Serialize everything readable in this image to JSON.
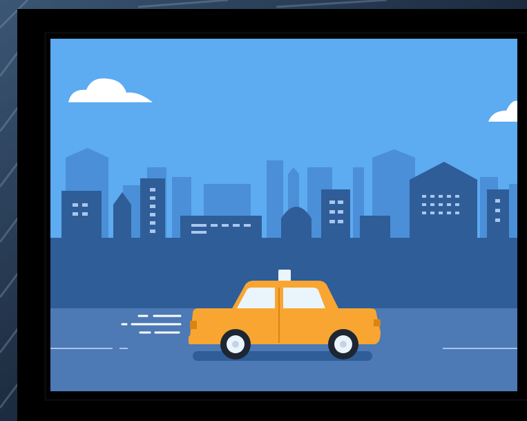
{
  "image": {
    "subject": "taxi-cab-city-street-illustration",
    "colors": {
      "sky": "#5dabf1",
      "skyline_far": "#4a8fd8",
      "skyline_near": "#2f5d98",
      "ground": "#3d6aa8",
      "road": "#4d79b5",
      "taxi_body": "#f8a532",
      "taxi_window": "#eaf4fb",
      "wheel": "#1e2633",
      "cloud": "#ffffff",
      "frame": "#000000"
    },
    "icons": [
      "cloud-icon",
      "taxi-icon",
      "speed-lines-icon",
      "building-icon"
    ]
  }
}
